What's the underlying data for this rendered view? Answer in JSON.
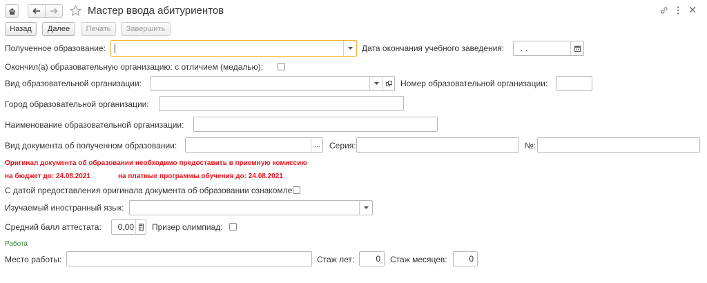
{
  "window": {
    "title": "Мастер ввода абитуриентов"
  },
  "toolbar": {
    "back_label": "Назад",
    "next_label": "Далее",
    "print_label": "Печать",
    "finish_label": "Завершить"
  },
  "education": {
    "received_label": "Полученное образование:",
    "received_value": "",
    "end_date_label": "Дата окончания учебного заведения:",
    "end_date_value": ". .",
    "honors_label": "Окончил(а) образовательную организацию:  с отличием (медалью):",
    "honors_checked": false
  },
  "organization": {
    "type_label": "Вид образовательной организации:",
    "type_value": "",
    "number_label": "Номер образовательной организации:",
    "number_value": "",
    "city_label": "Город образовательной организации:",
    "city_value": "",
    "name_label": "Наименование образовательной организации:",
    "name_value": ""
  },
  "document": {
    "type_label": "Вид документа об полученном образовании:",
    "type_value": "",
    "series_label": "Серия:",
    "series_value": "",
    "number_label": "№:",
    "number_value": ""
  },
  "notice": {
    "line1": "Оригинал документа об образовании необходимо предоставить в приемную комиссию",
    "budget": "на бюджет до: 24.08.2021",
    "paid": "на платные программы обучения до: 24.08.2021",
    "colors": {
      "notice": "#e6141e",
      "section": "#2f8a3c",
      "focus": "#f0b429"
    }
  },
  "acknowledge": {
    "label": "С датой предоставления оригинала документа об образовании ознакомлен:",
    "checked": false
  },
  "language": {
    "label": "Изучаемый иностранный язык:",
    "value": ""
  },
  "grades": {
    "avg_label": "Средний балл аттестата:",
    "avg_value": "0,00",
    "olympiad_label": "Призер олимпиад:",
    "olympiad_checked": false
  },
  "work": {
    "section_title": "Работа",
    "place_label": "Место работы:",
    "place_value": "",
    "years_label": "Стаж лет:",
    "years_value": "0",
    "months_label": "Стаж месяцев:",
    "months_value": "0"
  },
  "icons": [
    "home-icon",
    "back-arrow-icon",
    "forward-arrow-icon",
    "star-icon",
    "link-icon",
    "more-icon",
    "close-icon",
    "dropdown-icon",
    "calendar-icon",
    "open-icon",
    "ellipsis-icon",
    "calculator-icon"
  ]
}
